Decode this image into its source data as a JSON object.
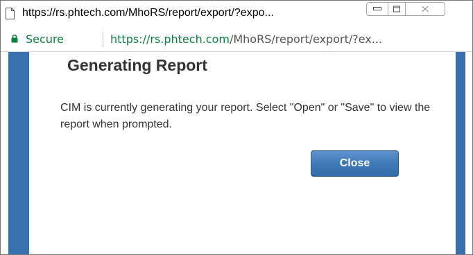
{
  "window": {
    "title": "https://rs.phtech.com/MhoRS/report/export/?expo...",
    "icons": {
      "page": "page-icon",
      "minimize": "minimize-icon",
      "maximize": "maximize-icon",
      "close": "close-icon"
    }
  },
  "address_bar": {
    "lock_icon": "lock-icon",
    "secure_label": "Secure",
    "url_scheme": "https://",
    "url_host": "rs.phtech.com",
    "url_path": "/MhoRS/report/export/?ex...",
    "colors": {
      "secure": "#0b8043",
      "path": "#555555"
    }
  },
  "dialog": {
    "title": "Generating Report",
    "message": "CIM is currently generating your report. Select \"Open\" or \"Save\" to view the report when prompted.",
    "close_button_label": "Close",
    "colors": {
      "backdrop": "#3871ad",
      "button": "#3f78b7",
      "text": "#333333"
    }
  }
}
